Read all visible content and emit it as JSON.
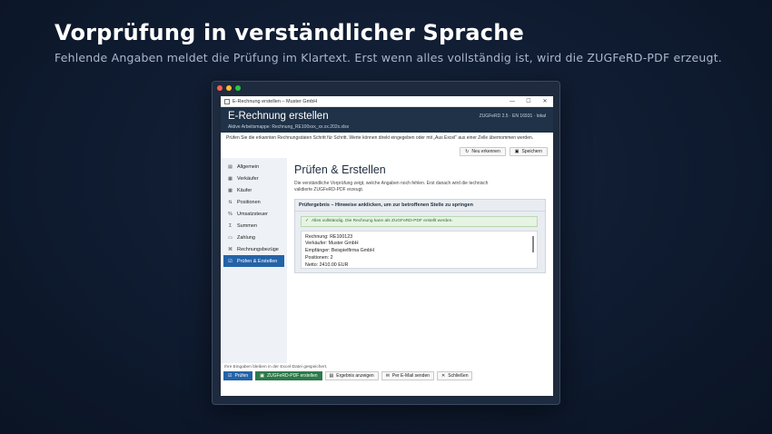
{
  "headline": "Vorprüfung in verständlicher Sprache",
  "subline": "Fehlende Angaben meldet die Prüfung im Klartext. Erst wenn alles vollständig ist, wird die ZUGFeRD-PDF erzeugt.",
  "window": {
    "title": "E-Rechnung erstellen – Muster GmbH",
    "minimize": "—",
    "maximize": "☐",
    "close": "✕"
  },
  "header": {
    "title": "E-Rechnung erstellen",
    "workspace": "Aktive Arbeitsmappe: Rechnung_RE100xxx_xx.xx.202x.xlsx",
    "standard": "ZUGFeRD 2.5 · EN 16931 · lokal"
  },
  "intro": "Prüfen Sie die erkannten Rechnungsdaten Schritt für Schritt. Werte können direkt eingegeben oder mit „Aus Excel“ aus einer Zelle übernommen werden.",
  "toolbar": {
    "new_label": "Neu erkennen",
    "new_icon": "↻",
    "save_label": "Speichern",
    "save_icon": "▣"
  },
  "sidebar": {
    "items": [
      {
        "label": "Allgemein",
        "icon": "▤"
      },
      {
        "label": "Verkäufer",
        "icon": "▦"
      },
      {
        "label": "Käufer",
        "icon": "▦"
      },
      {
        "label": "Positionen",
        "icon": "⇅"
      },
      {
        "label": "Umsatzsteuer",
        "icon": "%"
      },
      {
        "label": "Summen",
        "icon": "Σ"
      },
      {
        "label": "Zahlung",
        "icon": "▭"
      },
      {
        "label": "Rechnungsbezüge",
        "icon": "⌘"
      },
      {
        "label": "Prüfen & Erstellen",
        "icon": "☑"
      }
    ]
  },
  "main": {
    "title": "Prüfen & Erstellen",
    "description": "Die verständliche Vorprüfung zeigt, welche Angaben noch fehlen. Erst danach wird die technisch validierte ZUGFeRD-PDF erzeugt.",
    "panel_title": "Prüfergebnis – Hinweise anklicken, um zur betroffenen Stelle zu springen",
    "ok_message": "Alles vollständig. Die Rechnung kann als ZUGFeRD-PDF erstellt werden.",
    "ok_icon": "✓",
    "result_lines": [
      "Rechnung: RE100123",
      "Verkäufer: Muster GmbH",
      "Empfänger: Beispielfirma GmbH",
      "Positionen: 2",
      "Netto: 2410.00 EUR"
    ]
  },
  "footer_note": "Ihre Eingaben bleiben in der Excel-Datei gespeichert.",
  "bottom": {
    "check": "Prüfen",
    "check_icon": "☑",
    "create": "ZUGFeRD-PDF erstellen",
    "create_icon": "▣",
    "show": "Ergebnis anzeigen",
    "show_icon": "▤",
    "mail": "Per E-Mail senden",
    "mail_icon": "✉",
    "close": "Schließen",
    "close_icon": "✕"
  },
  "colors": {
    "header_bg": "#1f3247",
    "accent_blue": "#2563a8",
    "accent_green": "#2d7a4a",
    "ok_green": "#2e6b2e"
  }
}
